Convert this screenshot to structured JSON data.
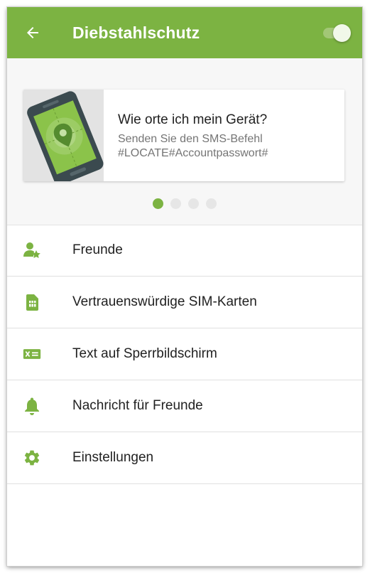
{
  "colors": {
    "accent": "#7cb342",
    "text_primary": "#212121",
    "text_secondary": "#757575"
  },
  "appbar": {
    "title": "Diebstahlschutz",
    "back_icon": "arrow-left-icon",
    "toggle_state": "on"
  },
  "banner": {
    "card": {
      "title": "Wie orte ich mein Gerät?",
      "text_line1": "Senden Sie den SMS-Befehl",
      "text_line2": "#LOCATE#Accountpasswort#",
      "illustration": "phone-location-icon"
    },
    "pages": 4,
    "active_page": 1
  },
  "menu": {
    "items": [
      {
        "label": "Freunde",
        "icon": "user-star-icon"
      },
      {
        "label": "Vertrauenswürdige SIM-Karten",
        "icon": "sim-card-icon"
      },
      {
        "label": "Text auf Sperrbildschirm",
        "icon": "text-card-icon"
      },
      {
        "label": "Nachricht für Freunde",
        "icon": "bell-icon"
      },
      {
        "label": "Einstellungen",
        "icon": "gear-icon"
      }
    ]
  }
}
